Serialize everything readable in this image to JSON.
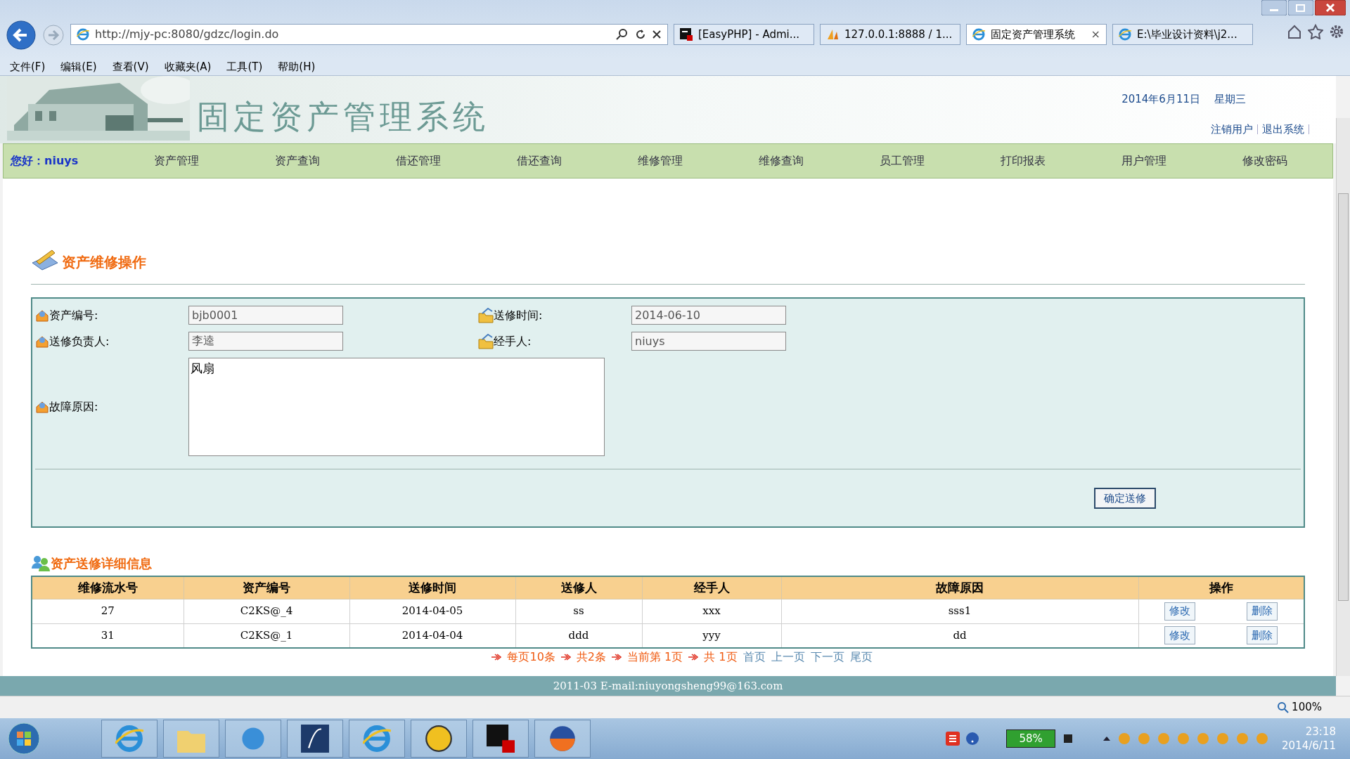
{
  "browser": {
    "address": "http://mjy-pc:8080/gdzc/login.do",
    "tabs": [
      {
        "label": "[EasyPHP] - Admi...",
        "kind": "black",
        "selected": false
      },
      {
        "label": "127.0.0.1:8888 / 1...",
        "kind": "pma",
        "selected": false
      },
      {
        "label": "固定资产管理系统",
        "kind": "ie",
        "selected": true,
        "close": "×"
      },
      {
        "label": "E:\\毕业设计资料\\j2...",
        "kind": "ie",
        "selected": false
      }
    ],
    "menu": [
      "文件(F)",
      "编辑(E)",
      "查看(V)",
      "收藏夹(A)",
      "工具(T)",
      "帮助(H)"
    ]
  },
  "header": {
    "title": "固定资产管理系统",
    "date": "2014年6月11日",
    "weekday": "星期三",
    "links": [
      "注销用户",
      "退出系统"
    ]
  },
  "nav": {
    "greeting": "您好：niuys",
    "items": [
      "资产管理",
      "资产查询",
      "借还管理",
      "借还查询",
      "维修管理",
      "维修查询",
      "员工管理",
      "打印报表",
      "用户管理",
      "修改密码"
    ]
  },
  "form": {
    "title": "资产维修操作",
    "fields": [
      {
        "label": "资产编号:",
        "value": "bjb0001",
        "kind": "asset"
      },
      {
        "label": "送修时间:",
        "value": "2014-06-10",
        "kind": "folder"
      },
      {
        "label": "送修负责人:",
        "value": "李逵",
        "kind": "asset"
      },
      {
        "label": "经手人:",
        "value": "niuys",
        "kind": "folder"
      }
    ],
    "reason": {
      "label": "故障原因:",
      "value": "风扇"
    },
    "submit": "确定送修"
  },
  "table": {
    "title": "资产送修详细信息",
    "columns": [
      "维修流水号",
      "资产编号",
      "送修时间",
      "送修人",
      "经手人",
      "故障原因",
      "操作"
    ],
    "rows": [
      {
        "cells": [
          "27",
          "C2KS@_4",
          "2014-04-05",
          "ss",
          "xxx",
          "sss1"
        ],
        "actions": [
          "修改",
          "删除"
        ]
      },
      {
        "cells": [
          "31",
          "C2KS@_1",
          "2014-04-04",
          "ddd",
          "yyy",
          "dd"
        ],
        "actions": [
          "修改",
          "删除"
        ]
      }
    ]
  },
  "pagination": {
    "info": [
      "每页10条",
      "共2条",
      "当前第 1页",
      "共 1页"
    ],
    "links": [
      "首页",
      "上一页",
      "下一页",
      "尾页"
    ]
  },
  "footer": "2011-03 E-mail:niuyongsheng99@163.com",
  "zoom": "100%",
  "taskbar": {
    "battery": "58%",
    "time": "23:18",
    "date": "2014/6/11"
  }
}
